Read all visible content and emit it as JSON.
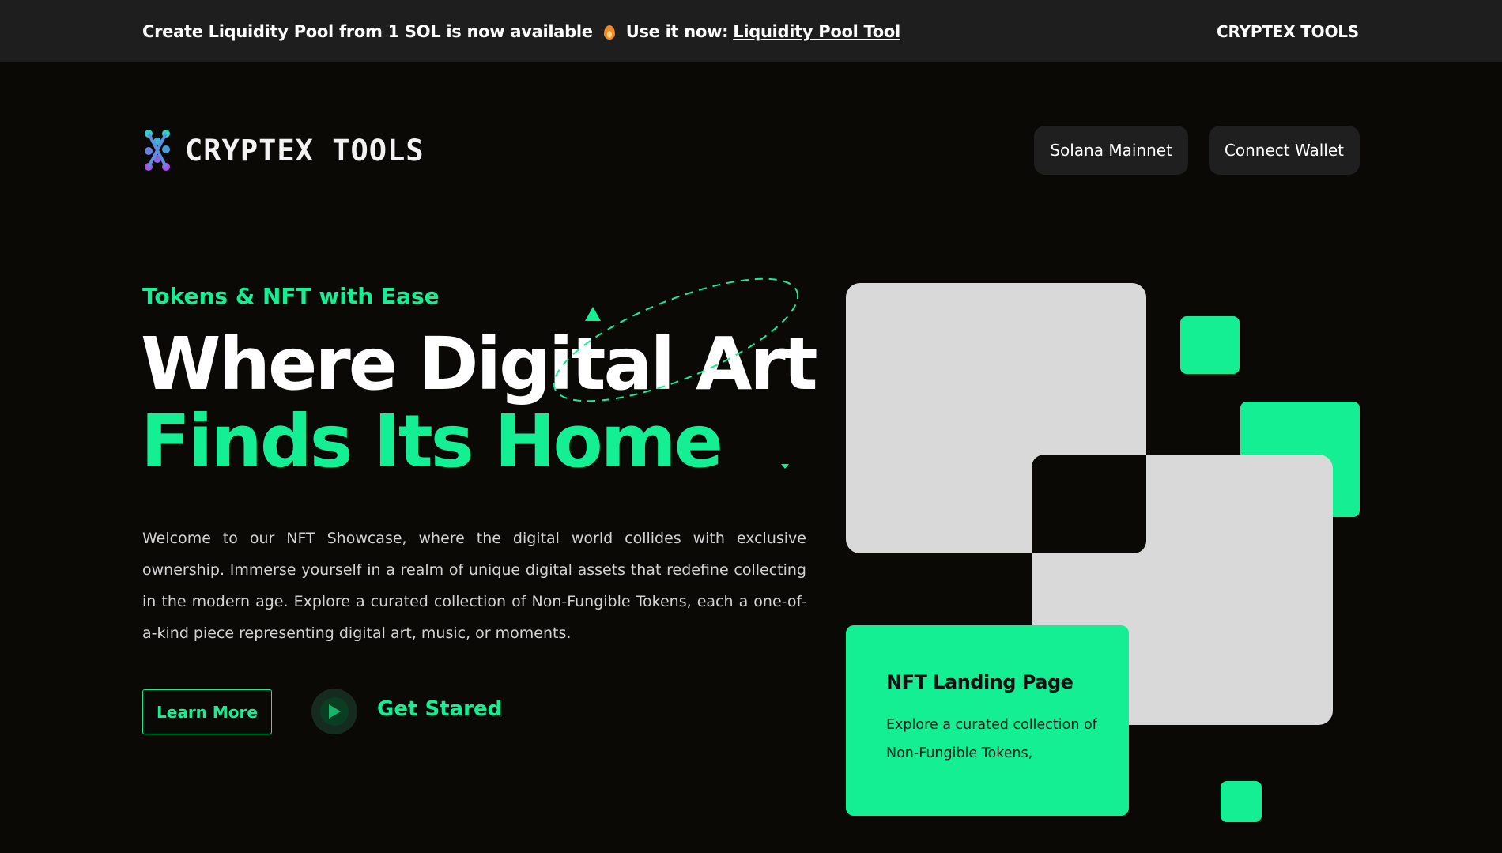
{
  "announcement": {
    "message": "Create Liquidity Pool from 1 SOL is now available",
    "icon": "fire-icon",
    "cta_prefix": "Use it now:",
    "cta_link": "Liquidity Pool Tool",
    "brand": "CRYPTEX TOOLS"
  },
  "header": {
    "logo_text": "CRYPTEX TOOLS",
    "network_button": "Solana Mainnet",
    "wallet_button": "Connect Wallet"
  },
  "hero": {
    "eyebrow": "Tokens & NFT with Ease",
    "title_line1": "Where Digital Art",
    "title_line2": "Finds Its Home",
    "description": "Welcome to our NFT Showcase, where the digital world collides with exclusive ownership. Immerse yourself in a realm of unique digital assets that redefine collecting in the modern age. Explore a curated collection of Non-Fungible Tokens, each a one-of-a-kind piece representing digital art, music, or moments.",
    "learn_more": "Learn More",
    "get_started": "Get Stared",
    "play_icon": "play-icon"
  },
  "card": {
    "title": "NFT Landing Page",
    "text": "Explore a curated collection of Non-Fungible Tokens,"
  },
  "colors": {
    "accent": "#14ef94",
    "background": "#0a0906",
    "topbar": "#1e1e1e",
    "panel": "#d9d9d9"
  }
}
